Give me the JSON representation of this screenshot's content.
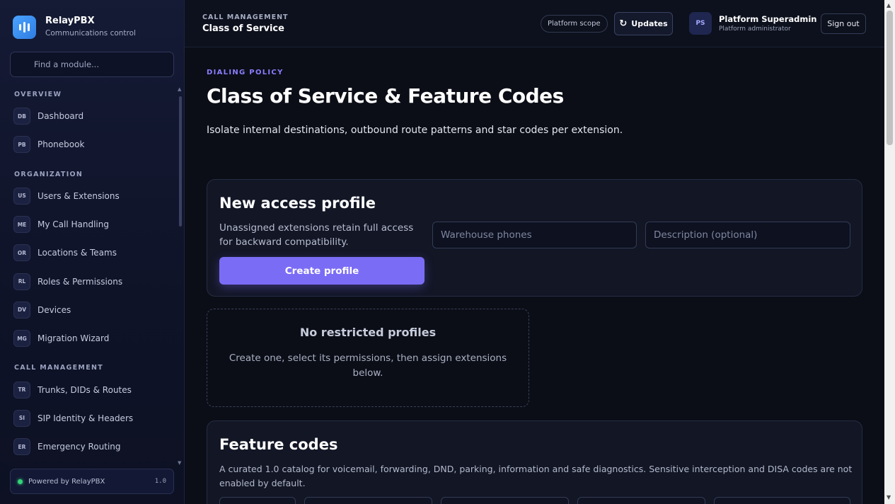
{
  "brand": {
    "name": "RelayPBX",
    "subtitle": "Communications control"
  },
  "sidebar": {
    "search_placeholder": "Find a module...",
    "sections": [
      {
        "title": "Overview",
        "items": [
          {
            "badge": "DB",
            "label": "Dashboard"
          },
          {
            "badge": "PB",
            "label": "Phonebook"
          }
        ]
      },
      {
        "title": "Organization",
        "items": [
          {
            "badge": "US",
            "label": "Users & Extensions"
          },
          {
            "badge": "ME",
            "label": "My Call Handling"
          },
          {
            "badge": "OR",
            "label": "Locations & Teams"
          },
          {
            "badge": "RL",
            "label": "Roles & Permissions"
          },
          {
            "badge": "DV",
            "label": "Devices"
          },
          {
            "badge": "MG",
            "label": "Migration Wizard"
          }
        ]
      },
      {
        "title": "Call Management",
        "items": [
          {
            "badge": "TR",
            "label": "Trunks, DIDs & Routes"
          },
          {
            "badge": "SI",
            "label": "SIP Identity & Headers"
          },
          {
            "badge": "ER",
            "label": "Emergency Routing"
          }
        ]
      }
    ],
    "footer": {
      "text": "Powered by RelayPBX",
      "version": "1.0"
    }
  },
  "header": {
    "section": "CALL MANAGEMENT",
    "title": "Class of Service",
    "scope": "Platform scope",
    "updates": "Updates",
    "user": {
      "initials": "PS",
      "name": "Platform Superadmin",
      "role": "Platform administrator"
    },
    "signout": "Sign out"
  },
  "page": {
    "eyebrow": "DIALING POLICY",
    "title": "Class of Service & Feature Codes",
    "description": "Isolate internal destinations, outbound route patterns and star codes per extension."
  },
  "profile_card": {
    "title": "New access profile",
    "hint": "Unassigned extensions retain full access for backward compatibility.",
    "name_placeholder": "Warehouse phones",
    "description_placeholder": "Description (optional)",
    "create_label": "Create profile"
  },
  "empty_state": {
    "title": "No restricted profiles",
    "description": "Create one, select its permissions, then assign extensions below."
  },
  "feature_codes": {
    "title": "Feature codes",
    "description": "A curated 1.0 catalog for voicemail, forwarding, DND, parking, information and safe diagnostics. Sensitive interception and DISA codes are not enabled by default."
  },
  "colors": {
    "accent": "#7b6cf6",
    "eyebrow": "#8b7dff",
    "status_ok": "#34d27a",
    "logo": "#4aa3ff"
  }
}
